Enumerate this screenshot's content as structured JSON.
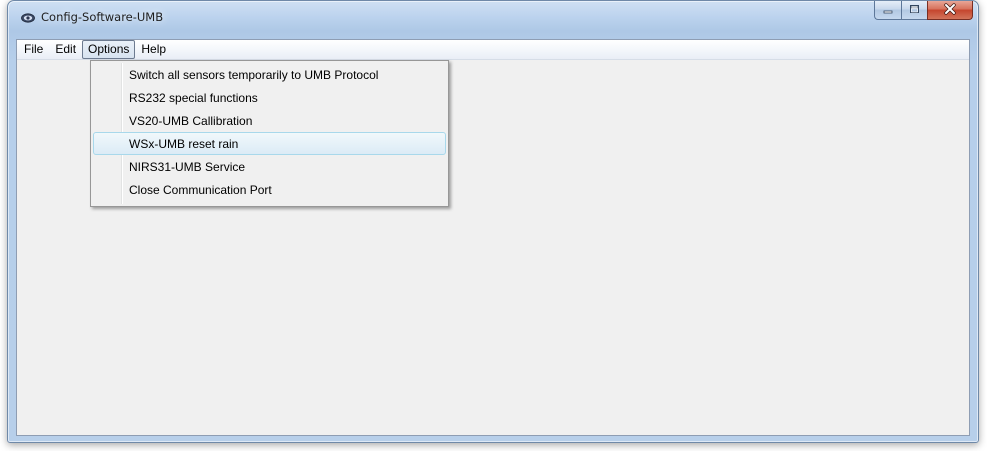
{
  "window": {
    "title": "Config-Software-UMB",
    "app_icon": "eye-icon",
    "caption_buttons": {
      "minimize_icon": "minimize-icon",
      "maximize_icon": "maximize-icon",
      "close_icon": "close-icon"
    }
  },
  "menubar": {
    "items": [
      {
        "label": "File"
      },
      {
        "label": "Edit"
      },
      {
        "label": "Options"
      },
      {
        "label": "Help"
      }
    ],
    "open_menu": "Options"
  },
  "options_menu": {
    "items": [
      {
        "label": "Switch all sensors temporarily to UMB Protocol"
      },
      {
        "label": "RS232 special functions"
      },
      {
        "label": "VS20-UMB Callibration"
      },
      {
        "label": "WSx-UMB reset rain"
      },
      {
        "label": "NIRS31-UMB Service"
      },
      {
        "label": "Close Communication Port"
      }
    ],
    "highlighted": "WSx-UMB reset rain"
  },
  "colors": {
    "accent": "#b7cfea",
    "menu_highlight_border": "#a8d8eb",
    "close_button": "#c5452d"
  }
}
